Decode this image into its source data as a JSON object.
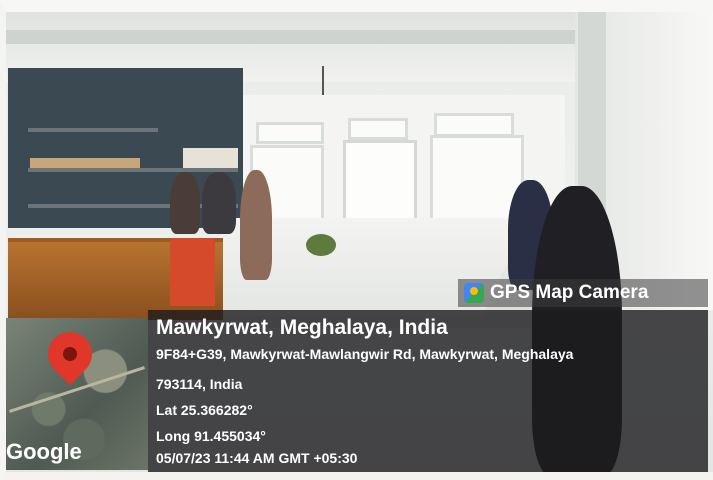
{
  "overlay": {
    "app_name": "GPS Map Camera",
    "location_title": "Mawkyrwat, Meghalaya, India",
    "address_line1": "9F84+G39, Mawkyrwat-Mawlangwir Rd, Mawkyrwat, Meghalaya",
    "address_line2": "793114, India",
    "latitude": "Lat 25.366282°",
    "longitude": "Long 91.455034°",
    "datetime": "05/07/23 11:44 AM GMT +05:30",
    "map_provider": "Google",
    "icons": [
      "gps-camera-logo-icon",
      "map-pin-icon"
    ]
  },
  "colors": {
    "overlay_bg": "#1c1c1e",
    "pin": "#e0372a",
    "text": "#ffffff"
  }
}
